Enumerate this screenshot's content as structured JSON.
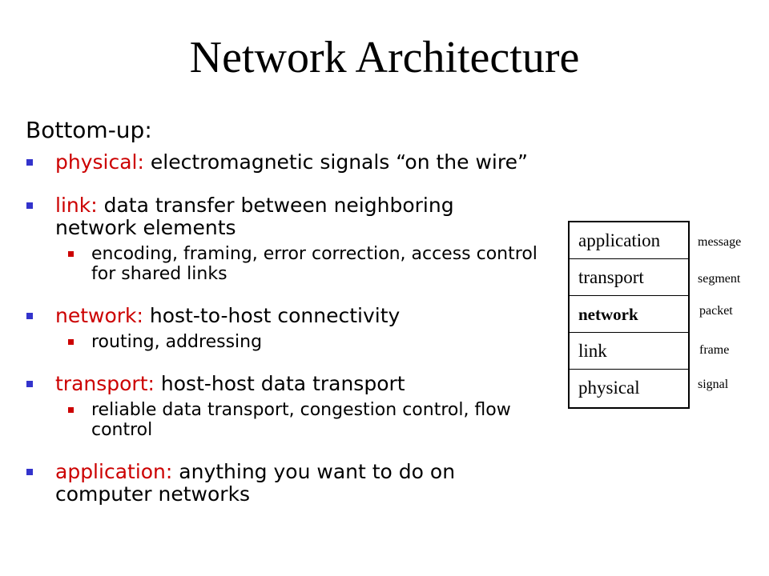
{
  "title": "Network Architecture",
  "heading": "Bottom-up:",
  "bullets": [
    {
      "term": "physical:",
      "text": "electromagnetic signals “on the wire”",
      "subs": []
    },
    {
      "term": "link:",
      "text": "data transfer between neighboring network elements",
      "subs": [
        "encoding, framing, error correction, access control for shared links"
      ]
    },
    {
      "term": "network:",
      "text": "host-to-host connectivity",
      "subs": [
        "routing, addressing"
      ]
    },
    {
      "term": "transport:",
      "text": "host-host data transport",
      "subs": [
        "reliable data transport, congestion control, flow control"
      ]
    },
    {
      "term": "application:",
      "text": "anything you want to do on computer networks",
      "subs": []
    }
  ],
  "stack": {
    "layers": [
      "application",
      "transport",
      "network",
      "link",
      "physical"
    ],
    "units": [
      "message",
      "segment",
      "packet",
      "frame",
      "signal"
    ]
  },
  "colors": {
    "term": "#cc0000",
    "bullet_marker": "#3333cc",
    "sub_marker": "#cc0000"
  }
}
